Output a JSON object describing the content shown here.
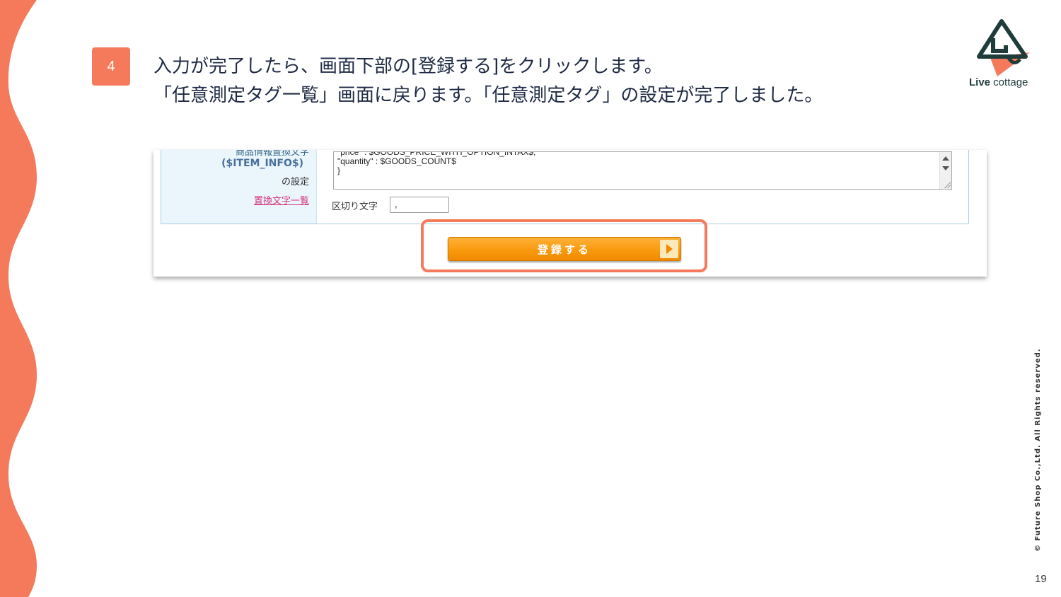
{
  "slide": {
    "step_number": "4",
    "instruction_line1": "入力が完了したら、画面下部の[登録する]をクリックします。",
    "instruction_line2": "「任意測定タグ一覧」画面に戻ります。「任意測定タグ」の設定が完了しました。",
    "page_number": "19",
    "copyright": "© Future Shop Co.,Ltd. All Rights reserved.",
    "accent_color": "#f47a5b"
  },
  "logo": {
    "bold": "Live",
    "rest": " cottage"
  },
  "form": {
    "label_cut": "商品情報置換文字",
    "label_var": "($ITEM_INFO$)",
    "label_setting": "の設定",
    "label_link": "置換文字一覧",
    "textarea_lines": [
      "\"price\" : $GOODS_PRICE_WITH_OPTION_INTAX$,",
      "  \"quantity\" : $GOODS_COUNT$",
      "}"
    ],
    "delimiter_label": "区切り文字",
    "delimiter_value": ","
  },
  "button": {
    "register_label": "登録する"
  }
}
